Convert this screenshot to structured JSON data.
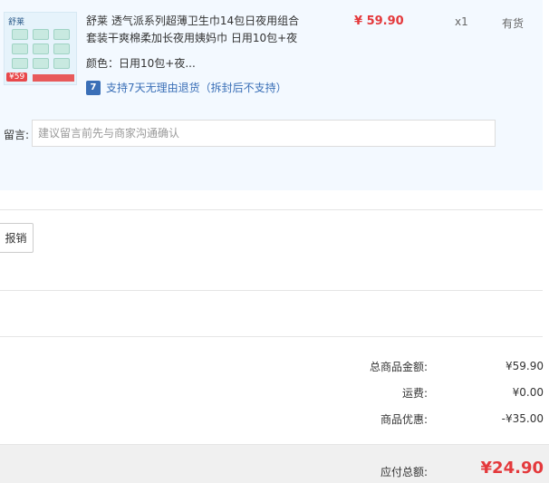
{
  "product": {
    "title": "舒莱 透气派系列超薄卫生巾14包日夜用组合套装干爽棉柔加长夜用姨妈巾 日用10包+夜",
    "price": "¥ 59.90",
    "quantity": "x1",
    "stock": "有货",
    "spec_key": "颜色：",
    "spec_value": "日用10包+夜...",
    "return_icon": "7",
    "return_policy": "支持7天无理由退货（拆封后不支持）",
    "thumb": {
      "logo": "舒莱",
      "price_tag": "¥59"
    }
  },
  "message": {
    "label": "留言:",
    "placeholder": "建议留言前先与商家沟通确认"
  },
  "reimburse_label": "报销",
  "summary": {
    "rows": [
      {
        "label": "总商品金额:",
        "value": "¥59.90"
      },
      {
        "label": "运费:",
        "value": "¥0.00"
      },
      {
        "label": "商品优惠:",
        "value": "-¥35.00"
      }
    ],
    "total_label": "应付总额:",
    "total_value": "¥24.90"
  },
  "colors": {
    "accent_red": "#e4393c",
    "link_blue": "#3a6fb7",
    "panel_bg": "#f3f9ff"
  }
}
